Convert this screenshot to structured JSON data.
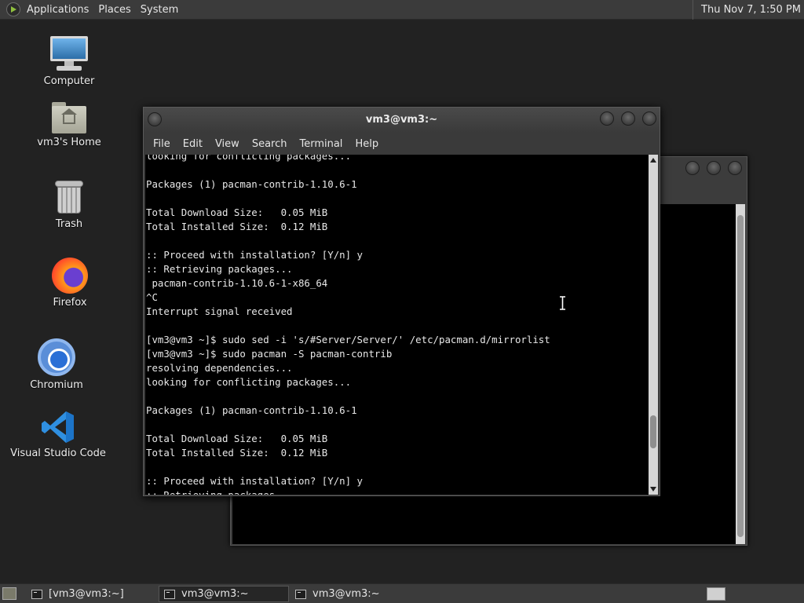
{
  "top_panel": {
    "menus": [
      "Applications",
      "Places",
      "System"
    ],
    "clock": "Thu Nov  7,  1:50 PM"
  },
  "desktop": {
    "icons": [
      {
        "label": "Computer",
        "icon": "computer-icon"
      },
      {
        "label": "vm3's Home",
        "icon": "home-folder-icon"
      },
      {
        "label": "Trash",
        "icon": "trash-icon"
      },
      {
        "label": "Firefox",
        "icon": "firefox-icon"
      },
      {
        "label": "Chromium",
        "icon": "chromium-icon"
      },
      {
        "label": "Visual Studio Code",
        "icon": "vscode-icon"
      }
    ]
  },
  "terminal": {
    "title": "vm3@vm3:~",
    "menu": [
      "File",
      "Edit",
      "View",
      "Search",
      "Terminal",
      "Help"
    ],
    "lines": [
      "looking for conflicting packages...",
      "",
      "Packages (1) pacman-contrib-1.10.6-1",
      "",
      "Total Download Size:   0.05 MiB",
      "Total Installed Size:  0.12 MiB",
      "",
      ":: Proceed with installation? [Y/n] y",
      ":: Retrieving packages...",
      " pacman-contrib-1.10.6-1-x86_64",
      "^C",
      "Interrupt signal received",
      "",
      "[vm3@vm3 ~]$ sudo sed -i 's/#Server/Server/' /etc/pacman.d/mirrorlist",
      "[vm3@vm3 ~]$ sudo pacman -S pacman-contrib",
      "resolving dependencies...",
      "looking for conflicting packages...",
      "",
      "Packages (1) pacman-contrib-1.10.6-1",
      "",
      "Total Download Size:   0.05 MiB",
      "Total Installed Size:  0.12 MiB",
      "",
      ":: Proceed with installation? [Y/n] y",
      ":: Retrieving packages..."
    ]
  },
  "taskbar": {
    "tasks": [
      "[vm3@vm3:~]",
      "vm3@vm3:~",
      "vm3@vm3:~"
    ],
    "active_index": 1
  }
}
